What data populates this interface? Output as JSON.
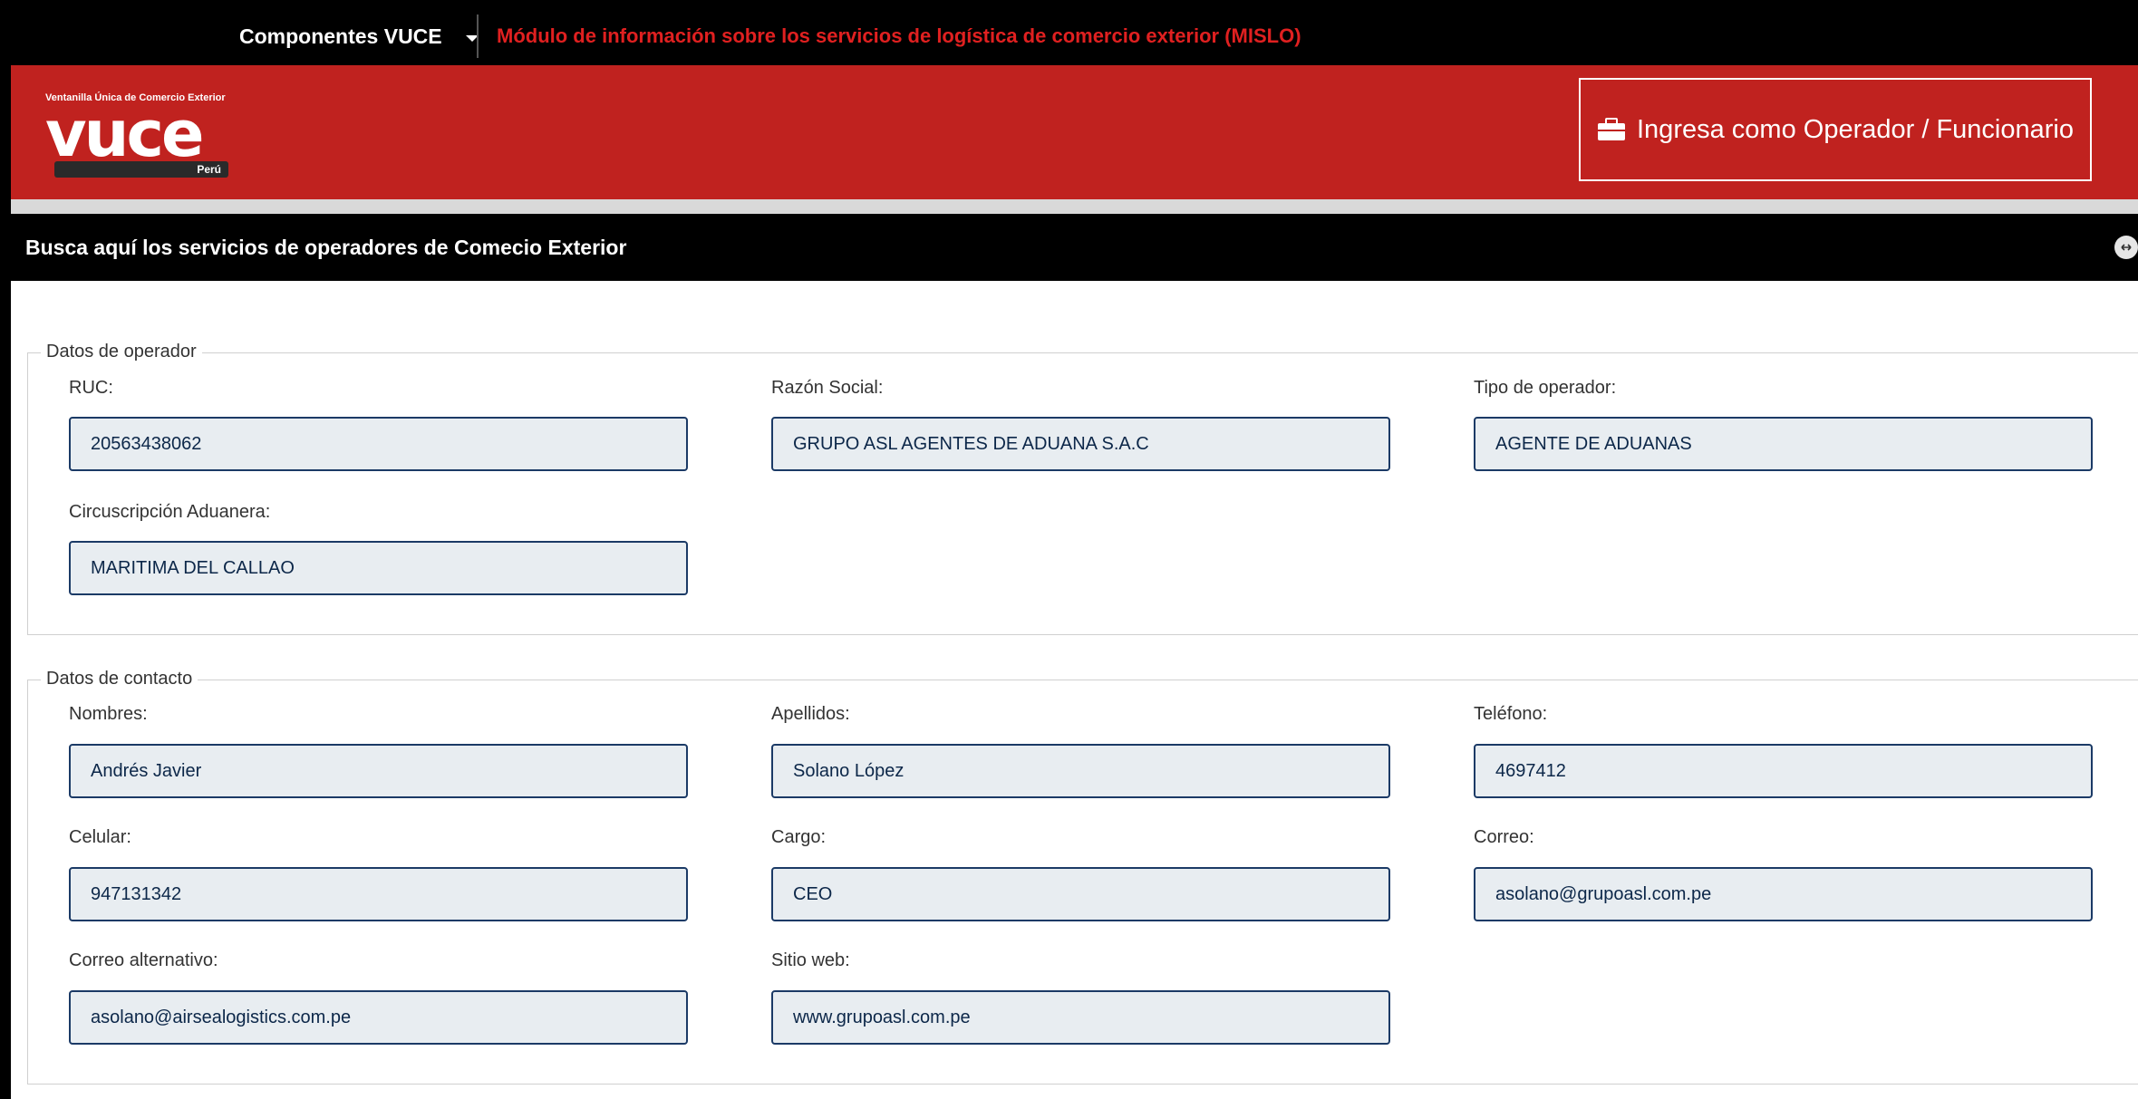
{
  "topbar": {
    "components_label": "Componentes VUCE",
    "module_title": "Módulo de información sobre los servicios de logística de comercio exterior (MISLO)"
  },
  "header": {
    "logo_small_text": "Ventanilla Única de Comercio Exterior",
    "logo_text": "vuce",
    "logo_country": "Perú",
    "login_label": "Ingresa como Operador / Funcionario"
  },
  "section": {
    "title": "Busca aquí los servicios de operadores de Comecio Exterior"
  },
  "operador": {
    "legend": "Datos de operador",
    "ruc_label": "RUC:",
    "ruc_value": "20563438062",
    "razon_label": "Razón Social:",
    "razon_value": "GRUPO ASL AGENTES DE ADUANA S.A.C",
    "tipo_label": "Tipo de operador:",
    "tipo_value": "AGENTE DE ADUANAS",
    "circ_label": "Circuscripción Aduanera:",
    "circ_value": "MARITIMA DEL CALLAO"
  },
  "contacto": {
    "legend": "Datos de contacto",
    "nombres_label": "Nombres:",
    "nombres_value": "Andrés Javier",
    "apellidos_label": "Apellidos:",
    "apellidos_value": "Solano López",
    "telefono_label": "Teléfono:",
    "telefono_value": "4697412",
    "celular_label": "Celular:",
    "celular_value": "947131342",
    "cargo_label": "Cargo:",
    "cargo_value": "CEO",
    "correo_label": "Correo:",
    "correo_value": "asolano@grupoasl.com.pe",
    "correo_alt_label": "Correo alternativo:",
    "correo_alt_value": "asolano@airsealogistics.com.pe",
    "web_label": "Sitio web:",
    "web_value": "www.grupoasl.com.pe"
  },
  "colors": {
    "brand_red": "#c0221f",
    "field_bg": "#e8edf1",
    "field_border": "#1b3a66",
    "module_red": "#e02020"
  }
}
